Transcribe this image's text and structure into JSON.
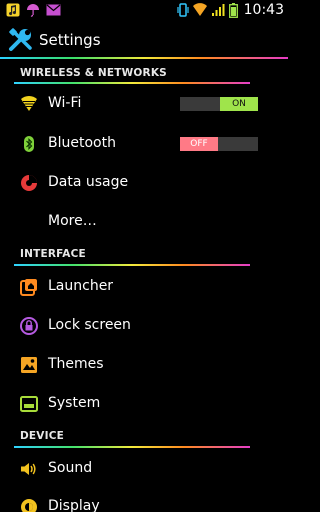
{
  "status_bar": {
    "time": "10:43",
    "icons": [
      "music-note-icon",
      "umbrella-icon",
      "mail-icon",
      "vibrate-icon",
      "wifi-icon",
      "signal-icon",
      "battery-icon"
    ]
  },
  "action_bar": {
    "title": "Settings",
    "icon": "tools-icon"
  },
  "sections": {
    "wireless": "WIRELESS & NETWORKS",
    "interface": "INTERFACE",
    "device": "DEVICE"
  },
  "items": {
    "wifi": {
      "label": "Wi-Fi",
      "toggle": "ON"
    },
    "bluetooth": {
      "label": "Bluetooth",
      "toggle": "OFF"
    },
    "data_usage": {
      "label": "Data usage"
    },
    "more": {
      "label": "More…"
    },
    "launcher": {
      "label": "Launcher"
    },
    "lock_screen": {
      "label": "Lock screen"
    },
    "themes": {
      "label": "Themes"
    },
    "system": {
      "label": "System"
    },
    "sound": {
      "label": "Sound"
    },
    "display": {
      "label": "Display"
    }
  },
  "colors": {
    "accent_green": "#9fe44b",
    "off_pink": "#ff7a86",
    "section_gradient": [
      "#2fd3ff",
      "#44e36d",
      "#f3ea3c",
      "#ff8b20",
      "#e53ec8"
    ]
  }
}
